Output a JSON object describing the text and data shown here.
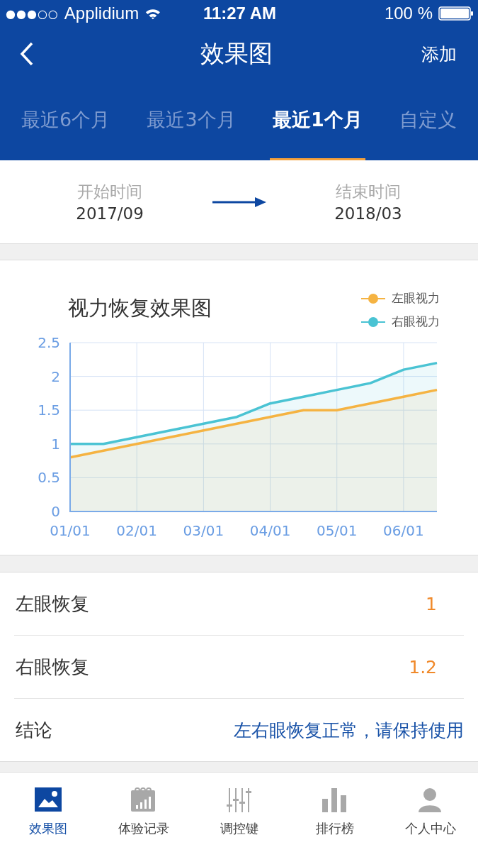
{
  "status_bar": {
    "signal_dots": "●●●○○",
    "carrier": "Applidium",
    "time": "11:27 AM",
    "battery": "100 %"
  },
  "nav_bar": {
    "title": "效果图",
    "action": "添加"
  },
  "tabs": [
    {
      "label": "最近6个月",
      "selected": false
    },
    {
      "label": "最近3个月",
      "selected": false
    },
    {
      "label": "最近1个月",
      "selected": true
    },
    {
      "label": "自定义",
      "selected": false
    }
  ],
  "date_range": {
    "start_label": "开始时间",
    "start_value": "2017/09",
    "end_label": "结束时间",
    "end_value": "2018/03"
  },
  "chart": {
    "chart_data": {
      "type": "area",
      "title": "视力恢复效果图",
      "categories": [
        "01/01",
        null,
        "02/01",
        null,
        "03/01",
        null,
        "04/01",
        null,
        "05/01",
        null,
        "06/01",
        null
      ],
      "series": [
        {
          "name": "左眼视力",
          "color": "#f5b342",
          "values": [
            0.8,
            0.9,
            1.0,
            1.1,
            1.2,
            1.3,
            1.4,
            1.5,
            1.5,
            1.6,
            1.7,
            1.8
          ]
        },
        {
          "name": "右眼视力",
          "color": "#4ac3d3",
          "values": [
            1.0,
            1.0,
            1.1,
            1.2,
            1.3,
            1.4,
            1.6,
            1.7,
            1.8,
            1.9,
            2.1,
            2.2
          ]
        }
      ],
      "ylim": [
        0,
        2.5
      ],
      "grid": true,
      "legend": "top-right",
      "yticks": [
        {
          "value": 0,
          "label": "0"
        },
        {
          "value": 0.5,
          "label": "0.5"
        },
        {
          "value": 1,
          "label": "1"
        },
        {
          "value": 1.5,
          "label": "1.5"
        },
        {
          "value": 2,
          "label": "2"
        },
        {
          "value": 2.5,
          "label": "2.5"
        }
      ]
    }
  },
  "results": [
    {
      "label": "左眼恢复",
      "value": "1",
      "kind": "number"
    },
    {
      "label": "右眼恢复",
      "value": "1.2",
      "kind": "number"
    },
    {
      "label": "结论",
      "value": "左右眼恢复正常，请保持使用",
      "kind": "text"
    }
  ],
  "tab_bar": [
    {
      "label": "效果图",
      "kind": "picture",
      "selected": true
    },
    {
      "label": "体验记录",
      "kind": "calendar",
      "selected": false
    },
    {
      "label": "调控键",
      "kind": "sliders",
      "selected": false
    },
    {
      "label": "排行榜",
      "kind": "bars",
      "selected": false
    },
    {
      "label": "个人中心",
      "kind": "person",
      "selected": false
    }
  ]
}
